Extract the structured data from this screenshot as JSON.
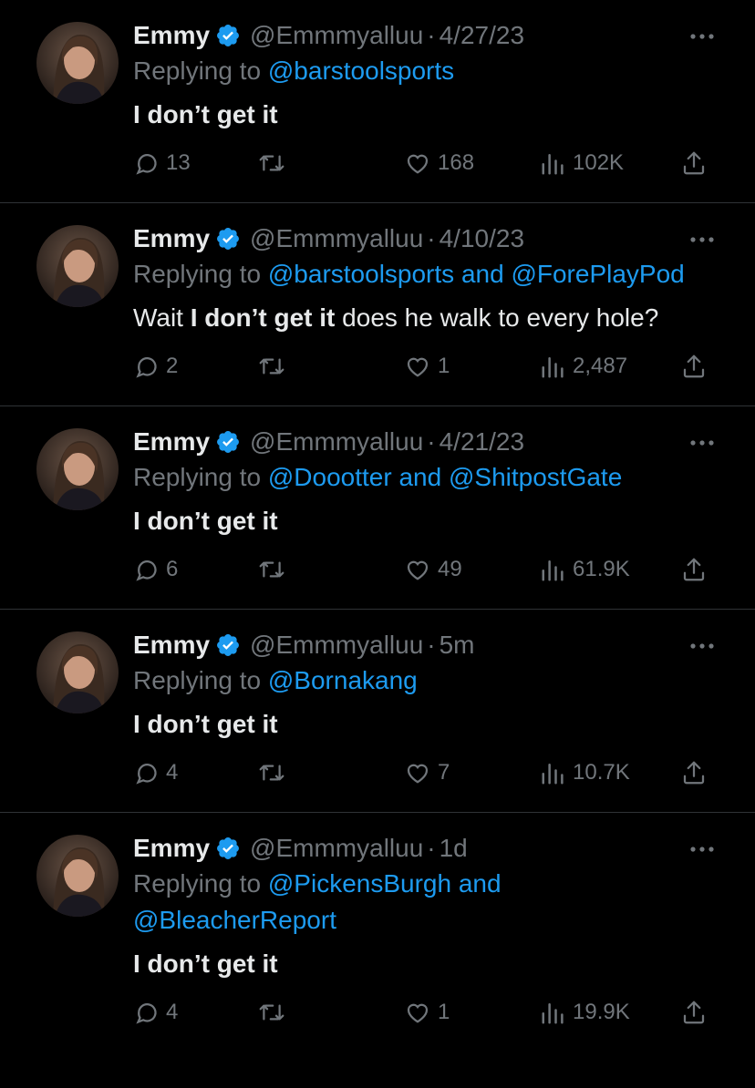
{
  "colors": {
    "background": "#000000",
    "text_primary": "#e7e9ea",
    "text_secondary": "#71767b",
    "accent_link": "#1d9bf0",
    "divider": "#2f3336"
  },
  "icons": {
    "verified": "verified-badge-icon",
    "more": "more-horizontal-icon",
    "reply": "reply-bubble-icon",
    "retweet": "retweet-icon",
    "like": "heart-icon",
    "views": "views-bars-icon",
    "share": "share-upload-icon"
  },
  "tweets": [
    {
      "name": "Emmy",
      "handle": "@Emmmyalluu",
      "dot": "·",
      "time": "4/27/23",
      "replying_prefix": "Replying to",
      "mention1": "@barstoolsports",
      "and": "",
      "mention2": "",
      "text_pre": "",
      "text_em": "I don’t get it",
      "text_post": "",
      "replies": "13",
      "retweets": "",
      "likes": "168",
      "views": "102K"
    },
    {
      "name": "Emmy",
      "handle": "@Emmmyalluu",
      "dot": "·",
      "time": "4/10/23",
      "replying_prefix": "Replying to",
      "mention1": "@barstoolsports",
      "and": "and",
      "mention2": "@ForePlayPod",
      "text_pre": "Wait ",
      "text_em": "I don’t get it",
      "text_post": " does he walk to every hole?",
      "replies": "2",
      "retweets": "",
      "likes": "1",
      "views": "2,487"
    },
    {
      "name": "Emmy",
      "handle": "@Emmmyalluu",
      "dot": "·",
      "time": "4/21/23",
      "replying_prefix": "Replying to",
      "mention1": "@Doootter",
      "and": "and",
      "mention2": "@ShitpostGate",
      "text_pre": "",
      "text_em": "I don’t get it",
      "text_post": "",
      "replies": "6",
      "retweets": "",
      "likes": "49",
      "views": "61.9K"
    },
    {
      "name": "Emmy",
      "handle": "@Emmmyalluu",
      "dot": "·",
      "time": "5m",
      "replying_prefix": "Replying to",
      "mention1": "@Bornakang",
      "and": "",
      "mention2": "",
      "text_pre": "",
      "text_em": "I don’t get it",
      "text_post": "",
      "replies": "4",
      "retweets": "",
      "likes": "7",
      "views": "10.7K"
    },
    {
      "name": "Emmy",
      "handle": "@Emmmyalluu",
      "dot": "·",
      "time": "1d",
      "replying_prefix": "Replying to",
      "mention1": "@PickensBurgh",
      "and": "and",
      "mention2": "@BleacherReport",
      "text_pre": "",
      "text_em": "I don’t get it",
      "text_post": "",
      "replies": "4",
      "retweets": "",
      "likes": "1",
      "views": "19.9K"
    }
  ]
}
